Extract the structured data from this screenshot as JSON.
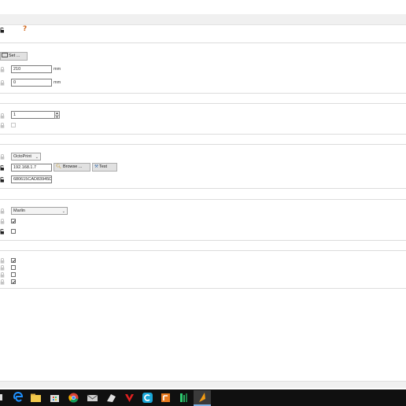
{
  "help": {
    "symbol": "?"
  },
  "bed": {
    "set_button": "Set ...",
    "width_value": "210",
    "width_unit": "mm",
    "offset_value": "0",
    "offset_unit": "mm"
  },
  "extruders": {
    "count_value": "1"
  },
  "host": {
    "type_selected": "OctoPrint",
    "address_value": "192.168.1.7",
    "browse_button": "Browse ...",
    "test_button": "Test",
    "apikey_value": "680615CAD83945D8"
  },
  "gcode": {
    "flavor_selected": "Marlin"
  },
  "colors": {
    "help_accent": "#d2691e",
    "taskbar_bg": "#101010",
    "separator": "#dcdcdc"
  },
  "taskbar_icons": [
    "windows-start-icon",
    "edge-browser-icon",
    "file-explorer-icon",
    "store-icon",
    "chrome-icon",
    "mail-icon",
    "slicer-icon",
    "red-v-icon",
    "ccleaner-icon",
    "fusion-icon",
    "orange-app-icon",
    "green-app-icon",
    "active-app-icon"
  ]
}
